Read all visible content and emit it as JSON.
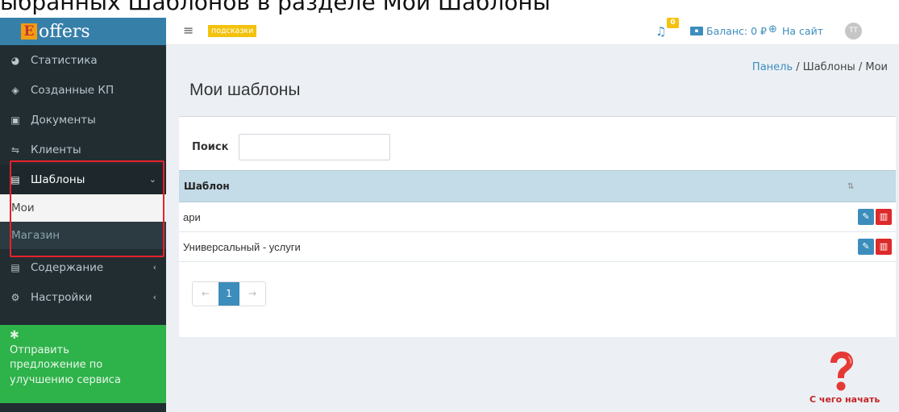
{
  "caption": "ыбранных Шаблонов в разделе Мои Шаблоны",
  "brand": {
    "mark": "E",
    "name": "offers"
  },
  "header": {
    "menu_icon": "hamburger-icon",
    "hints_label": "подсказки",
    "notifications_count": "0",
    "balance": "Баланс: 0 ₽",
    "to_site": "На сайт",
    "avatar": "TT"
  },
  "sidebar": {
    "items": [
      {
        "label": "Статистика",
        "icon": "dashboard-icon"
      },
      {
        "label": "Созданные КП",
        "icon": "eye-icon"
      },
      {
        "label": "Документы",
        "icon": "document-icon"
      },
      {
        "label": "Клиенты",
        "icon": "handshake-icon"
      },
      {
        "label": "Шаблоны",
        "icon": "file-icon"
      },
      {
        "label": "Мои"
      },
      {
        "label": "Магазин"
      },
      {
        "label": "Содержание",
        "icon": "file-icon"
      },
      {
        "label": "Настройки",
        "icon": "gears-icon"
      }
    ],
    "suggest": "Отправить предложение по улучшению сервиса"
  },
  "breadcrumb": {
    "panel": "Панель",
    "templates": "Шаблоны",
    "mine": "Мои"
  },
  "page": {
    "title": "Мои шаблоны"
  },
  "search": {
    "label": "Поиск",
    "value": ""
  },
  "table": {
    "header": "Шаблон",
    "rows": [
      "ари",
      "Универсальный - услуги"
    ]
  },
  "pagination": {
    "prev": "←",
    "current": "1",
    "next": "→"
  },
  "help": {
    "label": "С чего начать"
  },
  "colors": {
    "sidebar": "#222d32",
    "accent": "#3c8dbc",
    "suggest": "#2eb24a",
    "danger": "#dd2a2a",
    "highlight": "#e8202a"
  }
}
